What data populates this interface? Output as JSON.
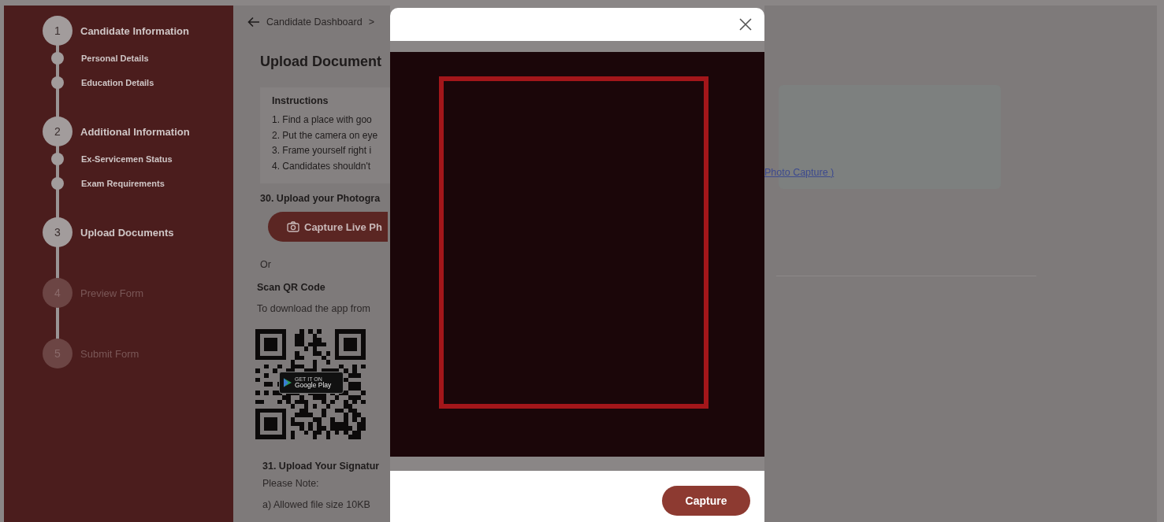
{
  "sidebar": {
    "steps": [
      {
        "number": "1",
        "label": "Candidate Information",
        "disabled": false,
        "children": [
          {
            "label": "Personal Details"
          },
          {
            "label": "Education Details"
          }
        ]
      },
      {
        "number": "2",
        "label": "Additional Information",
        "disabled": false,
        "children": [
          {
            "label": "Ex-Servicemen Status"
          },
          {
            "label": "Exam Requirements"
          }
        ]
      },
      {
        "number": "3",
        "label": "Upload Documents",
        "disabled": false
      },
      {
        "number": "4",
        "label": "Preview Form",
        "disabled": true
      },
      {
        "number": "5",
        "label": "Submit Form",
        "disabled": true
      }
    ]
  },
  "breadcrumb": {
    "items": [
      "Candidate Dashboard",
      ">"
    ]
  },
  "page_title": "Upload Document",
  "instructions": {
    "title": "Instructions",
    "items": [
      "1. Find a place with goo",
      "2. Put the camera on eye",
      "3. Frame yourself right i",
      "4. Candidates shouldn't"
    ]
  },
  "photo_question": "30. Upload your Photogra",
  "capture_live_button": "Capture Live Ph",
  "or_label": "Or",
  "scan_qr_title": "Scan QR Code",
  "scan_qr_text": "To download the app from",
  "store_badge": {
    "small": "GET IT ON",
    "large": "Google Play"
  },
  "signature_question": "31. Upload Your Signatur",
  "note_title": "Please Note:",
  "note_items": [
    "a) Allowed file size 10KB"
  ],
  "photo_capture_link": "Photo Capture )",
  "modal": {
    "capture_button": "Capture"
  }
}
